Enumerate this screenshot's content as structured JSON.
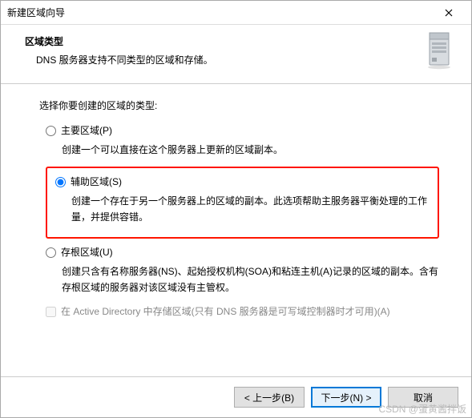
{
  "window": {
    "title": "新建区域向导"
  },
  "header": {
    "title": "区域类型",
    "subtitle": "DNS 服务器支持不同类型的区域和存储。"
  },
  "content": {
    "prompt": "选择你要创建的区域的类型:",
    "options": {
      "primary": {
        "label": "主要区域(P)",
        "desc": "创建一个可以直接在这个服务器上更新的区域副本。"
      },
      "secondary": {
        "label": "辅助区域(S)",
        "desc": "创建一个存在于另一个服务器上的区域的副本。此选项帮助主服务器平衡处理的工作量，并提供容错。"
      },
      "stub": {
        "label": "存根区域(U)",
        "desc": "创建只含有名称服务器(NS)、起始授权机构(SOA)和粘连主机(A)记录的区域的副本。含有存根区域的服务器对该区域没有主管权。"
      }
    },
    "ad_checkbox": "在 Active Directory 中存储区域(只有 DNS 服务器是可写域控制器时才可用)(A)"
  },
  "footer": {
    "back": "< 上一步(B)",
    "next": "下一步(N) >",
    "cancel": "取消"
  },
  "watermark": "CSDN @蛋黄酱拌饭"
}
